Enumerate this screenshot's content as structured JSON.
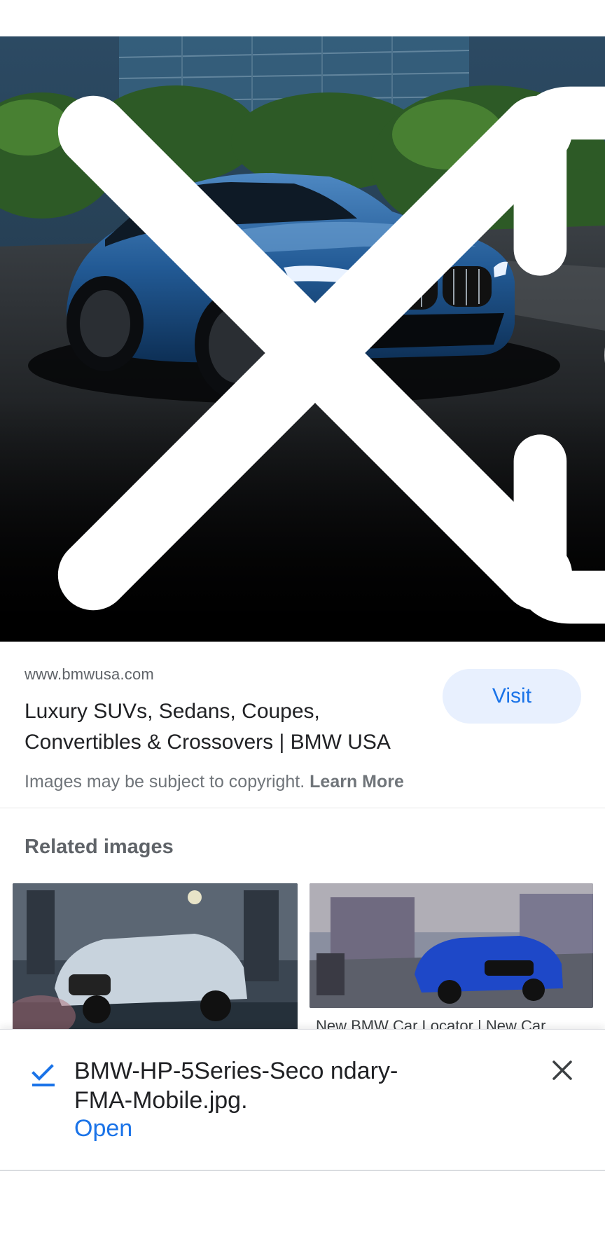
{
  "hero": {
    "close_icon": "close-icon",
    "lens_icon": "lens-icon",
    "share_icon": "share-icon"
  },
  "source": {
    "domain": "www.bmwusa.com",
    "title": "Luxury SUVs, Sedans, Coupes, Convertibles & Crossovers | BMW USA",
    "visit_label": "Visit",
    "copyright_text": "Images may be subject to copyright.",
    "learn_more": "Learn More"
  },
  "related": {
    "heading": "Related images",
    "items": [
      {
        "caption": ""
      },
      {
        "caption": "New BMW Car Locator | New Car"
      }
    ]
  },
  "download": {
    "filename": "BMW-HP-5Series-Seco ndary-FMA-Mobile.jpg.",
    "open_label": "Open",
    "check_icon": "download-done-icon",
    "close_icon": "close-icon"
  },
  "colors": {
    "accent": "#1a73e8",
    "visit_bg": "#e8f0fe",
    "text_primary": "#202124",
    "text_secondary": "#5f6368"
  }
}
